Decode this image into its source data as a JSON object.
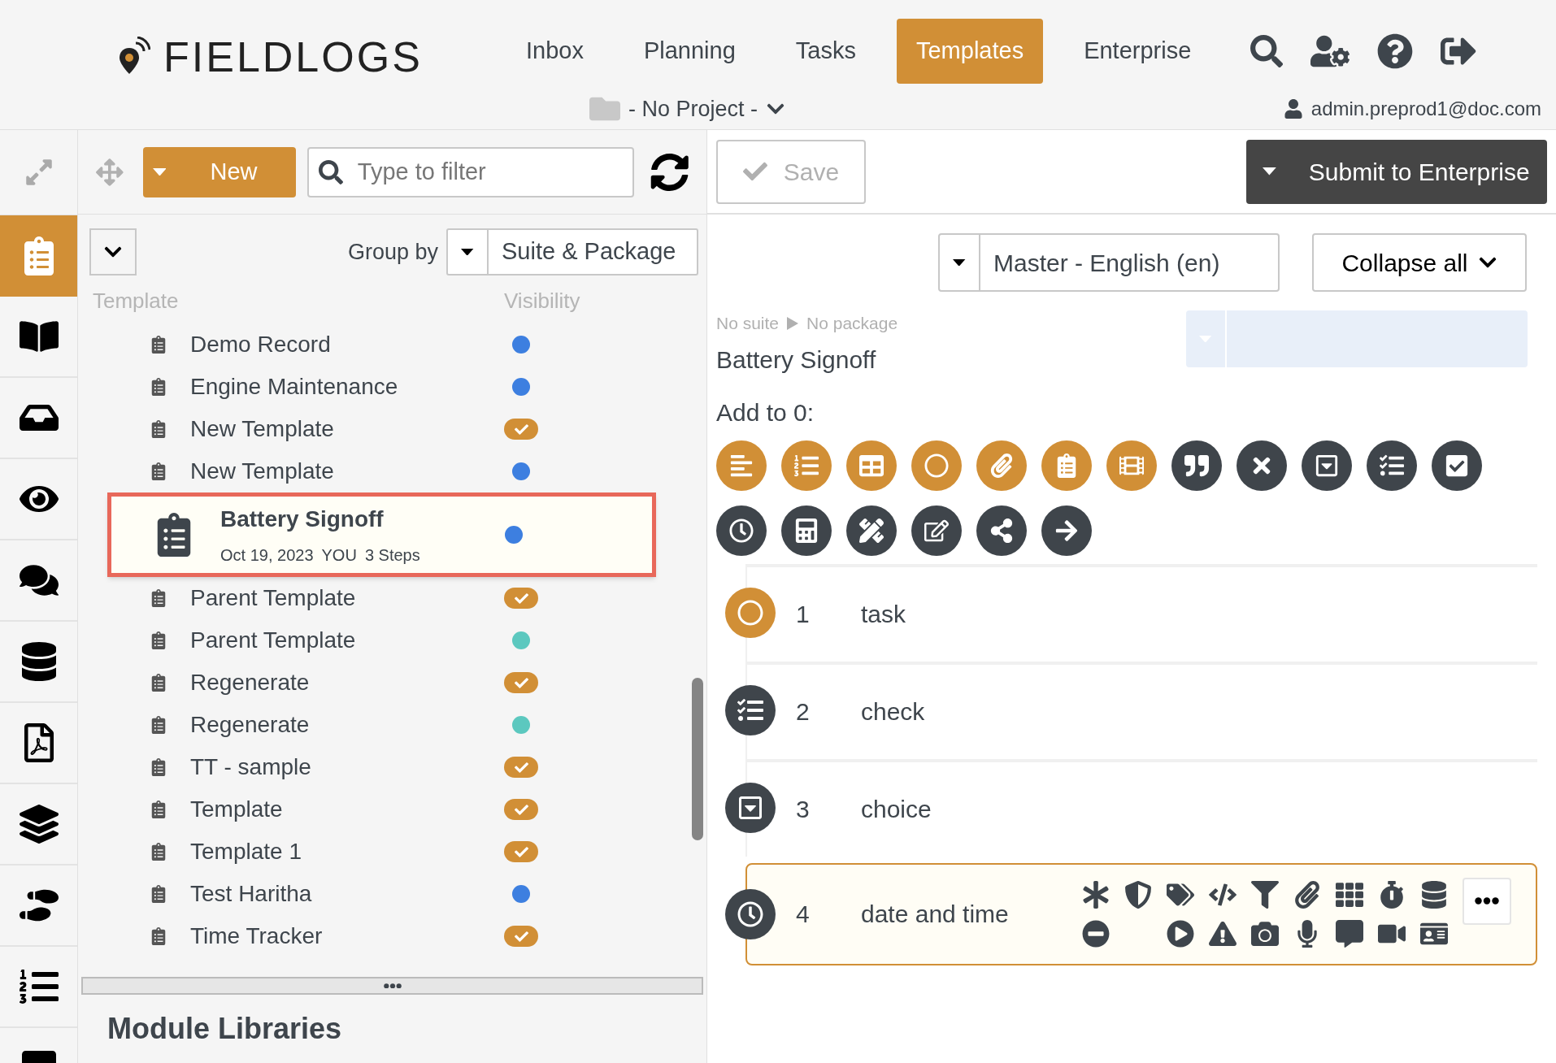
{
  "header": {
    "logo": "FIELDLOGS",
    "nav": [
      {
        "label": "Inbox",
        "selected": false
      },
      {
        "label": "Planning",
        "selected": false
      },
      {
        "label": "Tasks",
        "selected": false
      },
      {
        "label": "Templates",
        "selected": true
      },
      {
        "label": "Enterprise",
        "selected": false
      }
    ],
    "project": "- No Project -",
    "user": "admin.preprod1@doc.com"
  },
  "rail": [
    {
      "kind": "templates",
      "selected": true
    },
    {
      "kind": "book",
      "selected": false
    },
    {
      "kind": "inbox",
      "selected": false
    },
    {
      "kind": "eye",
      "selected": false
    },
    {
      "kind": "chat",
      "selected": false
    },
    {
      "kind": "database",
      "selected": false
    },
    {
      "kind": "pdf",
      "selected": false
    },
    {
      "kind": "layers",
      "selected": false
    },
    {
      "kind": "steps",
      "selected": false
    },
    {
      "kind": "list",
      "selected": false
    },
    {
      "kind": "more",
      "selected": false
    }
  ],
  "list_panel": {
    "new_button": "New",
    "filter_placeholder": "Type to filter",
    "group_by_label": "Group by",
    "group_by_value": "Suite & Package",
    "columns": [
      "Template",
      "Visibility"
    ],
    "templates": [
      {
        "name": "Demo Record",
        "kind": "dot",
        "color": "#3d7fe0",
        "selected": false
      },
      {
        "name": "Engine Maintenance",
        "kind": "dot",
        "color": "#3d7fe0",
        "selected": false
      },
      {
        "name": "New Template",
        "kind": "published",
        "selected": false
      },
      {
        "name": "New Template",
        "kind": "dot",
        "color": "#3d7fe0",
        "selected": false
      },
      {
        "name": "Battery Signoff",
        "kind": "dot",
        "color": "#3d7fe0",
        "selected": true,
        "date": "Oct 19, 2023",
        "author": "YOU",
        "steps": "3 Steps"
      },
      {
        "name": "Parent Template",
        "kind": "published",
        "selected": false
      },
      {
        "name": "Parent Template",
        "kind": "dot",
        "color": "#5cc8bf",
        "selected": false
      },
      {
        "name": "Regenerate",
        "kind": "published",
        "selected": false
      },
      {
        "name": "Regenerate",
        "kind": "dot",
        "color": "#5cc8bf",
        "selected": false
      },
      {
        "name": "TT - sample",
        "kind": "published",
        "selected": false
      },
      {
        "name": "Template",
        "kind": "published",
        "selected": false
      },
      {
        "name": "Template 1",
        "kind": "published",
        "selected": false
      },
      {
        "name": "Test Haritha",
        "kind": "dot",
        "color": "#3d7fe0",
        "selected": false
      },
      {
        "name": "Time Tracker",
        "kind": "published",
        "selected": false
      }
    ],
    "section_title": "Module Libraries"
  },
  "editor": {
    "save_button": "Save",
    "submit_button": "Submit to Enterprise",
    "language": "Master - English (en)",
    "collapse_button": "Collapse all",
    "breadcrumb": [
      "No suite",
      "No package"
    ],
    "title": "Battery Signoff",
    "add_label": "Add to 0:",
    "palette": [
      {
        "kind": "text",
        "color": "#d18f36"
      },
      {
        "kind": "list",
        "color": "#d18f36"
      },
      {
        "kind": "table",
        "color": "#d18f36"
      },
      {
        "kind": "task",
        "color": "#d18f36"
      },
      {
        "kind": "attachment",
        "color": "#d18f36"
      },
      {
        "kind": "template",
        "color": "#d18f36"
      },
      {
        "kind": "media",
        "color": "#d18f36"
      },
      {
        "kind": "quote",
        "color": "#3f454b"
      },
      {
        "kind": "passfail",
        "color": "#3f454b"
      },
      {
        "kind": "choice",
        "color": "#3f454b"
      },
      {
        "kind": "check",
        "color": "#3f454b"
      },
      {
        "kind": "checkbox",
        "color": "#3f454b"
      },
      {
        "kind": "date",
        "color": "#3f454b"
      },
      {
        "kind": "calc",
        "color": "#3f454b"
      },
      {
        "kind": "measure",
        "color": "#3f454b"
      },
      {
        "kind": "signature",
        "color": "#3f454b"
      },
      {
        "kind": "branch",
        "color": "#3f454b"
      },
      {
        "kind": "goto",
        "color": "#3f454b"
      }
    ],
    "steps": [
      {
        "number": "1",
        "label": "task",
        "kind": "task",
        "color": "#d18f36",
        "selected": false
      },
      {
        "number": "2",
        "label": "check",
        "kind": "check",
        "color": "#3f454b",
        "selected": false
      },
      {
        "number": "3",
        "label": "choice",
        "kind": "choice",
        "color": "#3f454b",
        "selected": false
      },
      {
        "number": "4",
        "label": "date and time",
        "kind": "date",
        "color": "#3f454b",
        "selected": true
      }
    ]
  }
}
